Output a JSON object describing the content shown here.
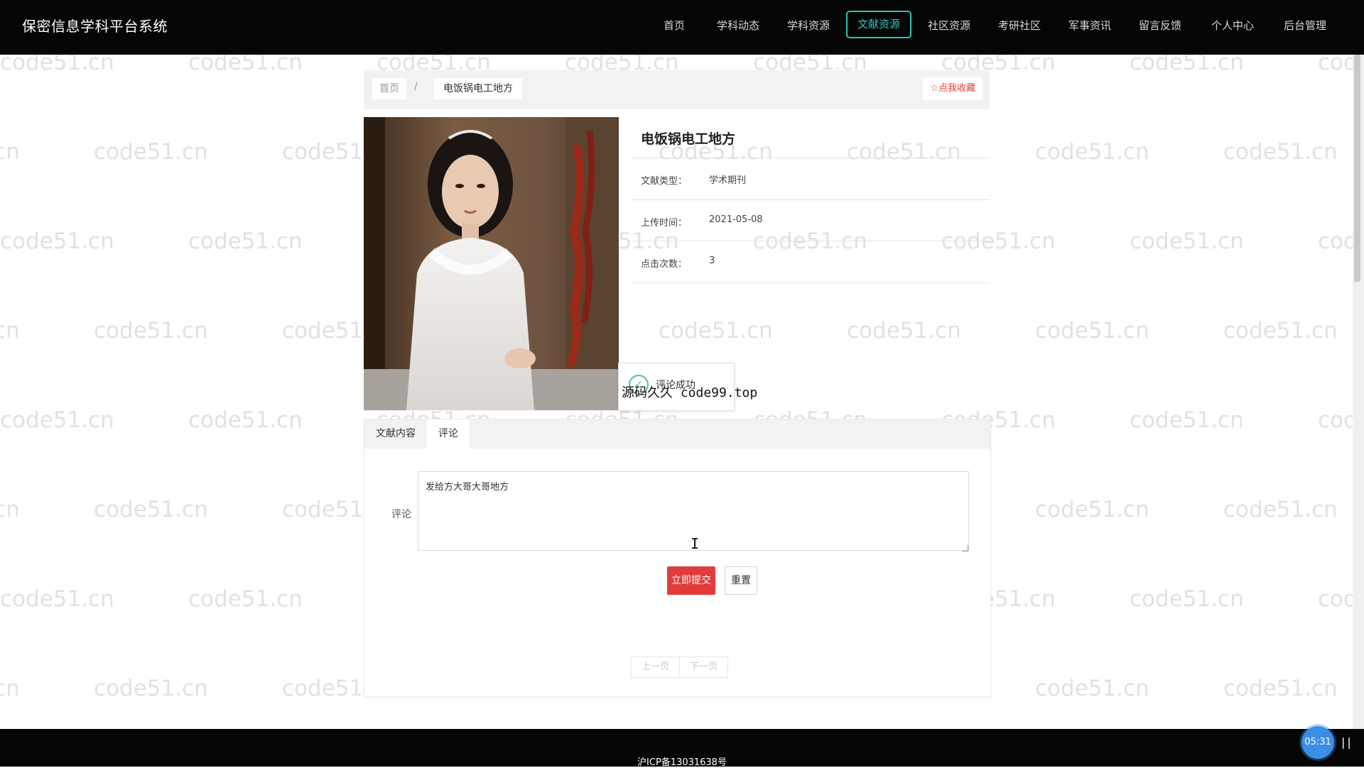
{
  "app": {
    "title": "保密信息学科平台系统"
  },
  "nav": {
    "items": [
      "首页",
      "学科动态",
      "学科资源",
      "文献资源",
      "社区资源",
      "考研社区",
      "军事资讯",
      "留言反馈",
      "个人中心",
      "后台管理"
    ],
    "active": "文献资源"
  },
  "watermark": "code51.cn",
  "breadcrumb": {
    "home": "首页",
    "separator": "/",
    "current": "电饭锅电工地方"
  },
  "favorite": {
    "icon": "star-icon",
    "label": "点我收藏"
  },
  "detail": {
    "title": "电饭锅电工地方",
    "fields": [
      {
        "label": "文献类型：",
        "value": "学术期刊"
      },
      {
        "label": "上传时间：",
        "value": "2021-05-08"
      },
      {
        "label": "点击次数：",
        "value": "3"
      }
    ]
  },
  "toast": {
    "icon": "check-circle-icon",
    "message": "评论成功"
  },
  "overlay": "源码久久 code99.top",
  "tabs": [
    {
      "label": "文献内容"
    },
    {
      "label": "评论"
    }
  ],
  "comment": {
    "label": "评论",
    "value": "发给方大哥大哥地方",
    "submit": "立即提交",
    "reset": "重置"
  },
  "pager": {
    "prev": "上一页",
    "next": "下一页"
  },
  "footer": {
    "icp": "沪ICP备13031638号"
  },
  "recorder": {
    "time": "05:31"
  },
  "colors": {
    "accent": "#2ec4b6",
    "primary_button": "#e23b3b",
    "topbar": "#050505"
  }
}
